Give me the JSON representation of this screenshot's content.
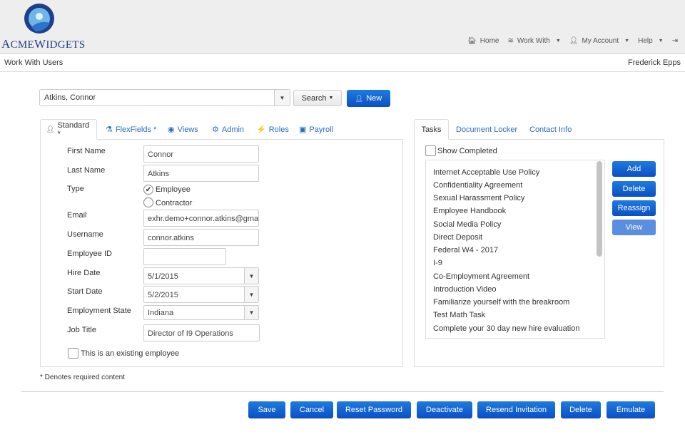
{
  "brand": {
    "name_first": "A",
    "name_rest": "CME",
    "name_second": "W",
    "name_second_rest": "IDGETS"
  },
  "nav": {
    "home": "Home",
    "work_with": "Work With",
    "my_account": "My Account",
    "help": "Help"
  },
  "subbar": {
    "title": "Work With Users",
    "user": "Frederick Epps"
  },
  "user_select": {
    "value": "Atkins, Connor"
  },
  "search_button": "Search",
  "new_button": "New",
  "left_tabs": [
    {
      "label": "Standard *",
      "icon": "user-icon"
    },
    {
      "label": "FlexFields *",
      "icon": "flask-icon"
    },
    {
      "label": "Views",
      "icon": "eye-icon"
    },
    {
      "label": "Admin",
      "icon": "gear-icon"
    },
    {
      "label": "Roles",
      "icon": "wand-icon"
    },
    {
      "label": "Payroll",
      "icon": "money-icon"
    }
  ],
  "form": {
    "first_name": {
      "label": "First Name",
      "value": "Connor"
    },
    "last_name": {
      "label": "Last Name",
      "value": "Atkins"
    },
    "type": {
      "label": "Type",
      "options": [
        "Employee",
        "Contractor"
      ],
      "selected": "Employee"
    },
    "email": {
      "label": "Email",
      "value": "exhr.demo+connor.atkins@gmai"
    },
    "username": {
      "label": "Username",
      "value": "connor.atkins"
    },
    "employee_id": {
      "label": "Employee ID",
      "value": ""
    },
    "hire_date": {
      "label": "Hire Date",
      "value": "5/1/2015"
    },
    "start_date": {
      "label": "Start Date",
      "value": "5/2/2015"
    },
    "employment_state": {
      "label": "Employment State",
      "value": "Indiana"
    },
    "job_title": {
      "label": "Job Title",
      "value": "Director of I9 Operations"
    },
    "existing_employee": {
      "label": "This is an existing employee",
      "checked": false
    }
  },
  "required_note": "* Denotes required content",
  "right_tabs": [
    "Tasks",
    "Document Locker",
    "Contact Info"
  ],
  "show_completed": {
    "label": "Show Completed",
    "checked": false
  },
  "tasks": [
    "Internet Acceptable Use Policy",
    "Confidentiality Agreement",
    "Sexual Harassment Policy",
    "Employee Handbook",
    "Social Media Policy",
    "Direct Deposit",
    "Federal W4 - 2017",
    "I-9",
    "Co-Employment Agreement",
    "Introduction Video",
    "Familiarize yourself with the breakroom",
    "Test Math Task",
    "Complete your 30 day new hire evaluation"
  ],
  "task_buttons": [
    "Add",
    "Delete",
    "Reassign",
    "View"
  ],
  "footer_buttons": [
    "Save",
    "Cancel",
    "Reset Password",
    "Deactivate",
    "Resend Invitation",
    "Delete",
    "Emulate"
  ],
  "colors": {
    "primary": "#0a4fc4",
    "link": "#2a6ebd",
    "brand": "#1e3f8a"
  }
}
